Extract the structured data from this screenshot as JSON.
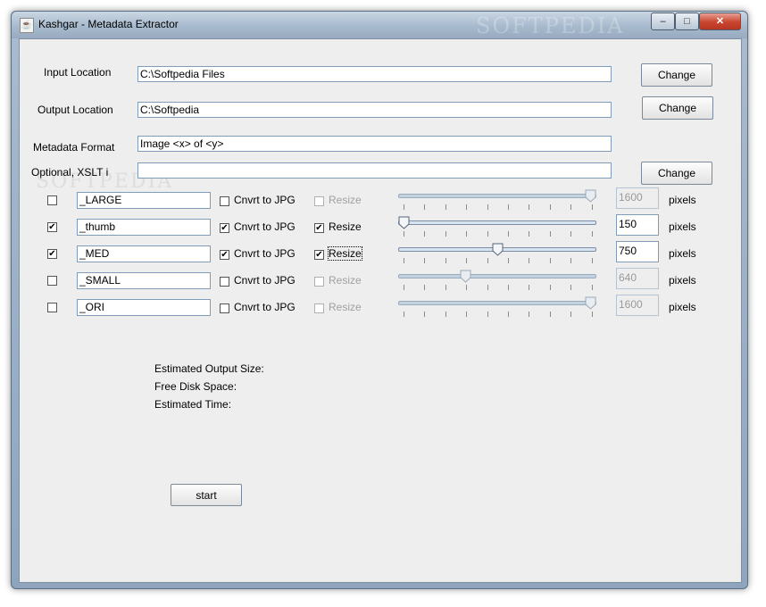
{
  "window": {
    "title": "Kashgar - Metadata Extractor",
    "icon": "java-cup-icon",
    "controls": {
      "minimize": "–",
      "maximize": "□",
      "close": "✕"
    },
    "watermark": "SOFTPEDIA"
  },
  "form": {
    "input_location": {
      "label": "Input Location",
      "value": "C:\\Softpedia Files",
      "button": "Change"
    },
    "output_location": {
      "label": "Output Location",
      "value": "C:\\Softpedia",
      "button": "Change"
    },
    "metadata_format": {
      "label": "Metadata Format",
      "value": "Image <x> of <y>"
    },
    "xslt": {
      "label": "Optional, XSLT i",
      "value": "",
      "button": "Change"
    }
  },
  "sizes": [
    {
      "enabled": false,
      "suffix": "_LARGE",
      "convert_label": "Cnvrt to JPG",
      "convert": false,
      "resize_label": "Resize",
      "resize": false,
      "slider_level": 1.0,
      "pixels": "1600",
      "unit": "pixels"
    },
    {
      "enabled": true,
      "suffix": "_thumb",
      "convert_label": "Cnvrt to JPG",
      "convert": true,
      "resize_label": "Resize",
      "resize": true,
      "slider_level": 0.0,
      "pixels": "150",
      "unit": "pixels"
    },
    {
      "enabled": true,
      "suffix": "_MED",
      "convert_label": "Cnvrt to JPG",
      "convert": true,
      "resize_label": "Resize",
      "resize": true,
      "slider_level": 0.5,
      "pixels": "750",
      "unit": "pixels"
    },
    {
      "enabled": false,
      "suffix": "_SMALL",
      "convert_label": "Cnvrt to JPG",
      "convert": false,
      "resize_label": "Resize",
      "resize": false,
      "slider_level": 0.33,
      "pixels": "640",
      "unit": "pixels"
    },
    {
      "enabled": false,
      "suffix": "_ORI",
      "convert_label": "Cnvrt to JPG",
      "convert": false,
      "resize_label": "Resize",
      "resize": false,
      "slider_level": 1.0,
      "pixels": "1600",
      "unit": "pixels"
    }
  ],
  "stats": {
    "output_size": "Estimated Output Size:",
    "disk_space": "Free Disk Space:",
    "time": "Estimated Time:"
  },
  "start_button": "start",
  "colors": {
    "client_bg": "#eeeeee",
    "field_border": "#7f9db9",
    "disabled_text": "#a0a0a0"
  }
}
